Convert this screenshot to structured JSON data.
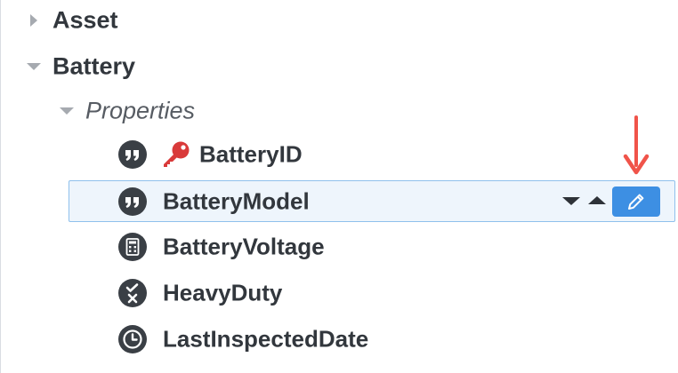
{
  "tree": {
    "categories": [
      {
        "label": "Asset",
        "expanded": false
      },
      {
        "label": "Battery",
        "expanded": true
      }
    ],
    "section": {
      "label": "Properties",
      "expanded": true
    },
    "properties": [
      {
        "label": "BatteryID",
        "type_icon": "text-quote-icon",
        "is_key": true,
        "key_icon": "key-icon"
      },
      {
        "label": "BatteryModel",
        "type_icon": "text-quote-icon",
        "is_key": false,
        "selected": true
      },
      {
        "label": "BatteryVoltage",
        "type_icon": "calculator-icon",
        "is_key": false
      },
      {
        "label": "HeavyDuty",
        "type_icon": "check-x-icon",
        "is_key": false
      },
      {
        "label": "LastInspectedDate",
        "type_icon": "clock-icon",
        "is_key": false
      }
    ]
  },
  "row_actions": {
    "move_down_icon": "caret-down-icon",
    "move_up_icon": "caret-up-icon",
    "edit_icon": "pencil-icon"
  },
  "annotation": {
    "icon": "red-arrow-down-icon"
  },
  "colors": {
    "text": "#32373d",
    "muted_triangle": "#a6aab0",
    "icon_dark": "#3a3f45",
    "key_red": "#d93a3a",
    "selection_border": "#8fc0ec",
    "selection_bg": "#eef5fc",
    "edit_button": "#3d8fe3",
    "annotation_arrow": "#f0544a"
  }
}
